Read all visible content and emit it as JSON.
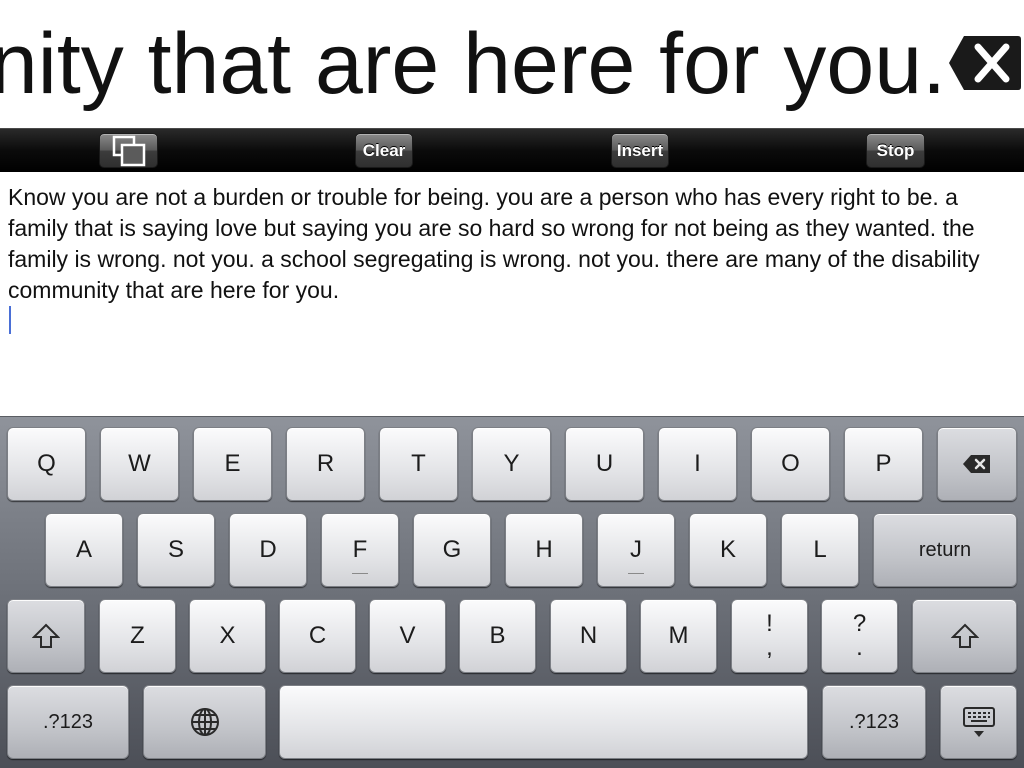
{
  "banner": {
    "text": "unity that are here for you.",
    "close_icon": "close-x-icon"
  },
  "toolbar": {
    "copy_icon": "copy-icon",
    "clear_label": "Clear",
    "insert_label": "Insert",
    "stop_label": "Stop"
  },
  "editor": {
    "text": "Know you are not a burden or trouble for being. you are a person who has every right to be. a family that is saying love but saying you are so hard so wrong for not being as they wanted. the family is wrong. not you. a school segregating is wrong. not you. there are many of the disability community that are here for you."
  },
  "keyboard": {
    "row1": [
      "Q",
      "W",
      "E",
      "R",
      "T",
      "Y",
      "U",
      "I",
      "O",
      "P"
    ],
    "row2": [
      "A",
      "S",
      "D",
      "F",
      "G",
      "H",
      "J",
      "K",
      "L"
    ],
    "row2_return": "return",
    "row3": [
      "Z",
      "X",
      "C",
      "V",
      "B",
      "N",
      "M"
    ],
    "excl_top": "!",
    "excl_bottom": ",",
    "q_top": "?",
    "q_bottom": ".",
    "numbers_label": ".?123",
    "icons": {
      "backspace": "backspace-icon",
      "shift": "shift-icon",
      "globe": "globe-icon",
      "hide": "hide-keyboard-icon"
    }
  }
}
